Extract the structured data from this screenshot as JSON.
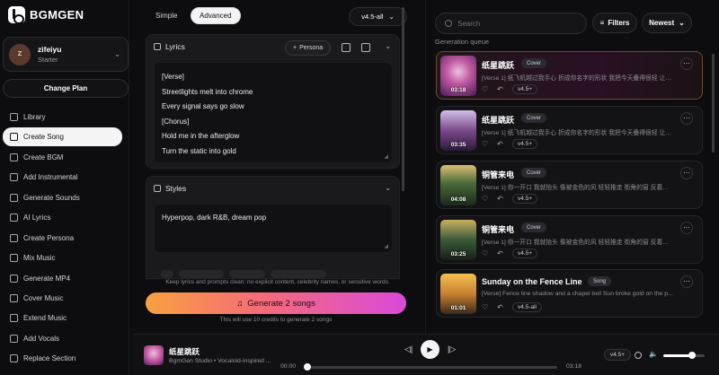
{
  "app": {
    "name": "BGMGEN"
  },
  "user": {
    "initial": "Z",
    "name": "zifeiyu",
    "plan": "Starter"
  },
  "sidebar": {
    "change_plan_label": "Change Plan",
    "items": [
      {
        "label": "Library",
        "icon": "library-icon"
      },
      {
        "label": "Create Song",
        "icon": "magic-wand-icon",
        "active": true
      },
      {
        "label": "Create BGM",
        "icon": "disc-icon"
      },
      {
        "label": "Add Instrumental",
        "icon": "instrument-icon"
      },
      {
        "label": "Generate Sounds",
        "icon": "sound-wave-icon"
      },
      {
        "label": "AI Lyrics",
        "icon": "microphone-icon"
      },
      {
        "label": "Create Persona",
        "icon": "persona-icon"
      },
      {
        "label": "Mix Music",
        "icon": "music-note-icon"
      },
      {
        "label": "Generate MP4",
        "icon": "video-icon"
      },
      {
        "label": "Cover Music",
        "icon": "waveform-icon"
      },
      {
        "label": "Extend Music",
        "icon": "extend-icon"
      },
      {
        "label": "Add Vocals",
        "icon": "vocals-icon"
      },
      {
        "label": "Replace Section",
        "icon": "replace-icon"
      }
    ]
  },
  "composer": {
    "modes": [
      "Simple",
      "Advanced"
    ],
    "active_mode": "Advanced",
    "model": "v4.5-all",
    "lyrics": {
      "title": "Lyrics",
      "persona_label": "Persona",
      "lines": [
        "[Verse]",
        "Streetlights melt into chrome",
        "Every signal says go slow",
        "[Chorus]",
        "Hold me in the afterglow",
        "Turn the static into gold"
      ]
    },
    "styles": {
      "title": "Styles",
      "value": "Hyperpop, dark R&B, dream pop"
    },
    "hint": "Keep lyrics and prompts clean: no explicit content, celebrity names, or sensitive words.",
    "generate_label": "Generate 2 songs",
    "credit_note": "This will use 10 credits to generate 2 songs"
  },
  "queue": {
    "search_placeholder": "Search",
    "filters_label": "Filters",
    "sort_label": "Newest",
    "section_label": "Generation queue",
    "songs": [
      {
        "title": "纸星跳跃",
        "tag": "Cover",
        "desc": "[Verse 1] 纸飞机越过我手心 折成你名字的形状 我把今天叠得很轻 让心...",
        "version": "v4.5+",
        "duration": "03:18"
      },
      {
        "title": "纸星跳跃",
        "tag": "Cover",
        "desc": "[Verse 1] 纸飞机越过我手心 折成你名字的形状 我把今天叠得很轻 让心...",
        "version": "v4.5+",
        "duration": "03:35"
      },
      {
        "title": "铜管来电",
        "tag": "Cover",
        "desc": "[Verse 1] 你一开口 我就抬头 像被金色的风 轻轻推走 街角的窗 反着你的...",
        "version": "v4.5+",
        "duration": "04:08"
      },
      {
        "title": "铜管来电",
        "tag": "Cover",
        "desc": "[Verse 1] 你一开口 我就抬头 像被金色的风 轻轻推走 街角的窗 反着你的...",
        "version": "v4.5+",
        "duration": "03:25"
      },
      {
        "title": "Sunday on the Fence Line",
        "tag": "Song",
        "desc": "[Verse] Fence line shadow and a chapel bell Sun broke gold on the p...",
        "version": "v4.5-all",
        "duration": "01:01"
      }
    ]
  },
  "player": {
    "title": "纸星跳跃",
    "subtitle": "BgmGen Studio • Vocaloid-inspired ...",
    "time_current": "00:00",
    "time_total": "03:18",
    "version": "v4.5+",
    "progress": 0,
    "volume": 0.7
  }
}
